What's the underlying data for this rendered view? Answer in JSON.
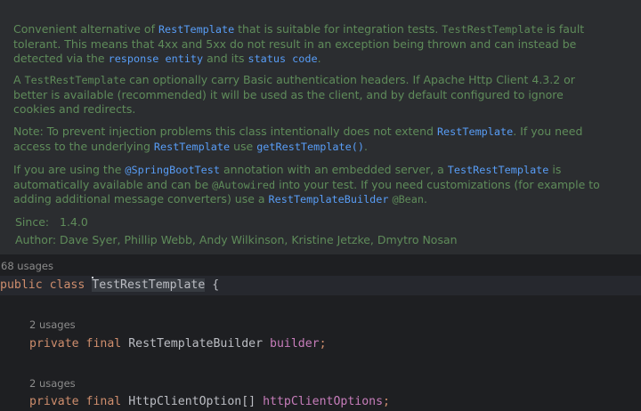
{
  "doc": {
    "p1": {
      "t1": "Convenient alternative of ",
      "c1": "RestTemplate",
      "t2": " that is suitable for integration tests. ",
      "c2": "TestRestTemplate",
      "t3": " is fault tolerant. This means that 4xx and 5xx do not result in an exception being thrown and can instead be detected via the ",
      "c3": "response entity",
      "t4": " and its ",
      "c4": "status code",
      "t5": "."
    },
    "p2": {
      "t1": "A ",
      "c1": "TestRestTemplate",
      "t2": " can optionally carry Basic authentication headers. If Apache Http Client 4.3.2 or better is available (recommended) it will be used as the client, and by default configured to ignore cookies and redirects."
    },
    "p3": {
      "t1": "Note: To prevent injection problems this class intentionally does not extend ",
      "c1": "RestTemplate",
      "t2": ". If you need access to the underlying ",
      "c2": "RestTemplate",
      "t3": " use ",
      "c3": "getRestTemplate()",
      "t4": "."
    },
    "p4": {
      "t1": "If you are using the ",
      "c1": "@SpringBootTest",
      "t2": " annotation with an embedded server, a ",
      "c2": "TestRestTemplate",
      "t3": " is automatically available and can be ",
      "c3": "@Autowired",
      "t4": " into your test. If you need customizations (for example to adding additional message converters) use a ",
      "c4": "RestTemplateBuilder",
      "t5": " ",
      "c5": "@Bean",
      "t6": "."
    },
    "since_label": "Since:",
    "since_value": "1.4.0",
    "author_label": "Author:",
    "author_value": "Dave Syer, Phillip Webb, Andy Wilkinson, Kristine Jetzke, Dmytro Nosan"
  },
  "code": {
    "class_usages": "68 usages",
    "kw_public": "public",
    "kw_class": "class",
    "class_name": "TestRestTemplate",
    "brace": " {",
    "f1_usages": "2 usages",
    "f1_kw_private": "private",
    "f1_kw_final": "final",
    "f1_type": "RestTemplateBuilder",
    "f1_name": "builder",
    "f1_semi": ";",
    "f2_usages": "2 usages",
    "f2_kw_private": "private",
    "f2_kw_final": "final",
    "f2_type": "HttpClientOption[]",
    "f2_name": "httpClientOptions",
    "f2_semi": ";"
  },
  "colors": {
    "doc_text": "#5f8c5a",
    "doc_link": "#589df6",
    "keyword": "#cf8e6d",
    "field": "#c77dbb",
    "default_text": "#bcbec4",
    "background": "#1e1f22"
  }
}
